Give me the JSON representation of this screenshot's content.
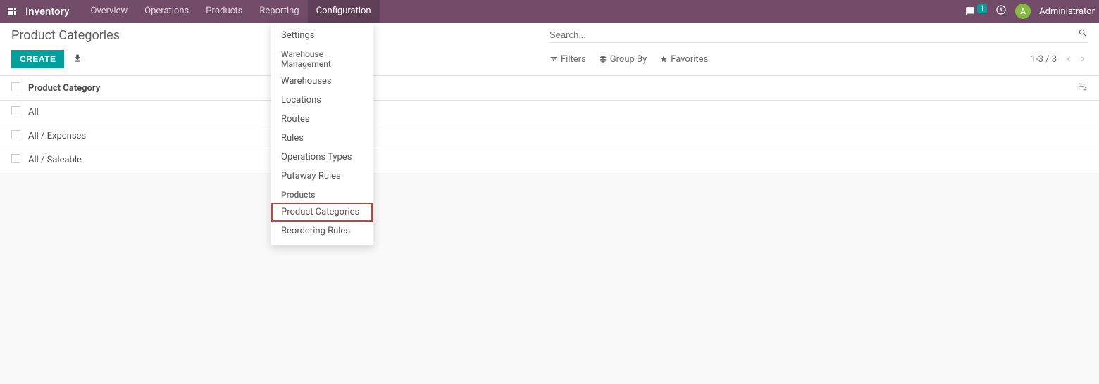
{
  "navbar": {
    "brand": "Inventory",
    "items": [
      {
        "label": "Overview"
      },
      {
        "label": "Operations"
      },
      {
        "label": "Products"
      },
      {
        "label": "Reporting"
      },
      {
        "label": "Configuration"
      }
    ],
    "chat_badge": "1",
    "user_initial": "A",
    "user_name": "Administrator"
  },
  "page": {
    "title": "Product Categories",
    "search_placeholder": "Search...",
    "create_label": "CREATE"
  },
  "search_options": {
    "filters": "Filters",
    "group_by": "Group By",
    "favorites": "Favorites"
  },
  "pager": "1-3 / 3",
  "table": {
    "header": "Product Category",
    "rows": [
      {
        "name": "All"
      },
      {
        "name": "All / Expenses"
      },
      {
        "name": "All / Saleable"
      }
    ]
  },
  "dropdown": {
    "settings": "Settings",
    "section_wm": "Warehouse Management",
    "wm_items": [
      {
        "label": "Warehouses"
      },
      {
        "label": "Locations"
      },
      {
        "label": "Routes"
      },
      {
        "label": "Rules"
      },
      {
        "label": "Operations Types"
      },
      {
        "label": "Putaway Rules"
      }
    ],
    "section_products": "Products",
    "prod_items": [
      {
        "label": "Product Categories",
        "highlighted": true
      },
      {
        "label": "Reordering Rules"
      }
    ]
  }
}
